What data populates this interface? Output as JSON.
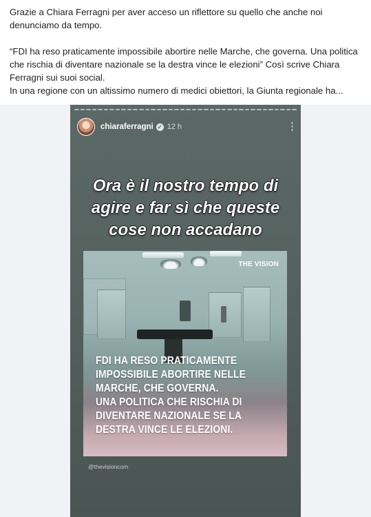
{
  "post": {
    "line1": "Grazie a Chiara Ferragni per aver acceso un riflettore su quello che anche noi denunciamo da tempo.",
    "quote": "“FDI ha reso praticamente impossibile abortire nelle Marche, che governa. Una politica che rischia di diventare nazionale se la destra vince le elezioni” Così scrive Chiara Ferragni sui suoi social.",
    "line3": "In una regione con un altissimo numero di medici obiettori, la Giunta regionale ha..."
  },
  "story": {
    "username": "chiaraferragni",
    "time": "12 h",
    "headline": "Ora è il nostro tempo di agire e far sì che queste cose non accadano",
    "card": {
      "logo": "THE VISION",
      "lines": [
        "FDI HA RESO PRATICAMENTE",
        "IMPOSSIBILE ABORTIRE NELLE",
        "MARCHE, CHE GOVERNA.",
        "UNA POLITICA CHE RISCHIA DI",
        "DIVENTARE NAZIONALE SE LA",
        "DESTRA VINCE LE ELEZIONI."
      ]
    },
    "handle": "@thevisioncom"
  },
  "icons": {
    "verified": "verified-badge-icon",
    "more": "more-vertical-icon"
  },
  "colors": {
    "story_bg": "#56625f",
    "text": "#1c1e21",
    "media_bg": "#f0f2f5"
  }
}
